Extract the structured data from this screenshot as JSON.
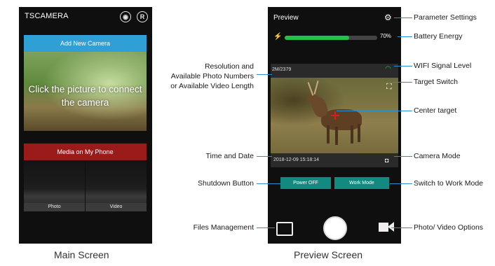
{
  "main_screen": {
    "app_title": "TSCAMERA",
    "header_icons": [
      "globe-icon",
      "registered-icon"
    ],
    "registered_symbol": "R",
    "add_camera_label": "Add New Camera",
    "connect_hint": "Click the picture to connect the camera",
    "media_label": "Media on My Phone",
    "thumb_photo": "Photo",
    "thumb_video": "Video",
    "caption": "Main Screen"
  },
  "preview_screen": {
    "title": "Preview",
    "battery_percent": 70,
    "battery_text": "70%",
    "resolution_text": "2M/2379",
    "datetime_text": "2018-12-09 15:18:14",
    "power_button": "Power OFF",
    "work_button": "Work Mode",
    "caption": "Preview Screen",
    "colors": {
      "battery": "#22c24a",
      "wifi": "#27c24a",
      "buttons": "#128a80",
      "crosshair": "#e01b1b"
    }
  },
  "annotations": {
    "parameter_settings": "Parameter Settings",
    "battery_energy": "Battery Energy",
    "wifi_signal": "WIFI Signal Level",
    "target_switch": "Target Switch",
    "center_target": "Center target",
    "camera_mode": "Camera Mode",
    "switch_work_mode": "Switch to Work Mode",
    "photo_video_options": "Photo/ Video Options",
    "resolution_line1": "Resolution and",
    "resolution_line2": "Available Photo Numbers",
    "resolution_line3": "or Available Video Length",
    "time_date": "Time and Date",
    "shutdown_button": "Shutdown Button",
    "files_management": "Files Management"
  }
}
